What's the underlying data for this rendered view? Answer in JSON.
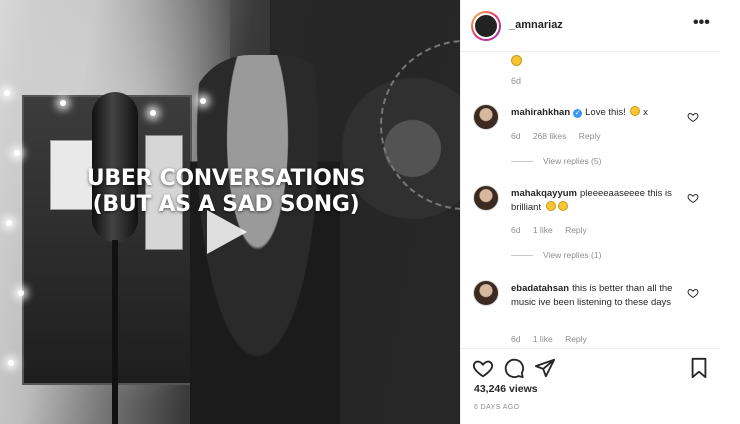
{
  "video": {
    "title_line1": "UBER CONVERSATIONS",
    "title_line2": "(BUT AS A SAD SONG)"
  },
  "header": {
    "username": "_amnariaz",
    "more_icon": "more-horizontal-icon"
  },
  "previous_comment": {
    "time": "6d"
  },
  "comments": [
    {
      "username": "mahirahkhan",
      "verified": true,
      "text": "Love this!",
      "suffix": "x",
      "time": "6d",
      "likes": "268 likes",
      "reply_label": "Reply",
      "view_replies": "View replies (5)"
    },
    {
      "username": "mahakqayyum",
      "verified": false,
      "text": "pleeeeaaseeee this is brilliant",
      "time": "6d",
      "likes": "1 like",
      "reply_label": "Reply",
      "view_replies": "View replies (1)"
    },
    {
      "username": "ebadatahsan",
      "verified": false,
      "text": "this is better than all the music ive been listening to these days",
      "time": "6d",
      "likes": "1 like",
      "reply_label": "Reply"
    }
  ],
  "actions": {
    "like_icon": "heart-icon",
    "comment_icon": "comment-icon",
    "share_icon": "send-icon",
    "save_icon": "bookmark-icon"
  },
  "stats": {
    "views": "43,246 views",
    "posted": "6 DAYS AGO"
  },
  "colors": {
    "verified": "#3897f0",
    "muted_text": "#8e8e8e",
    "text": "#262626"
  }
}
